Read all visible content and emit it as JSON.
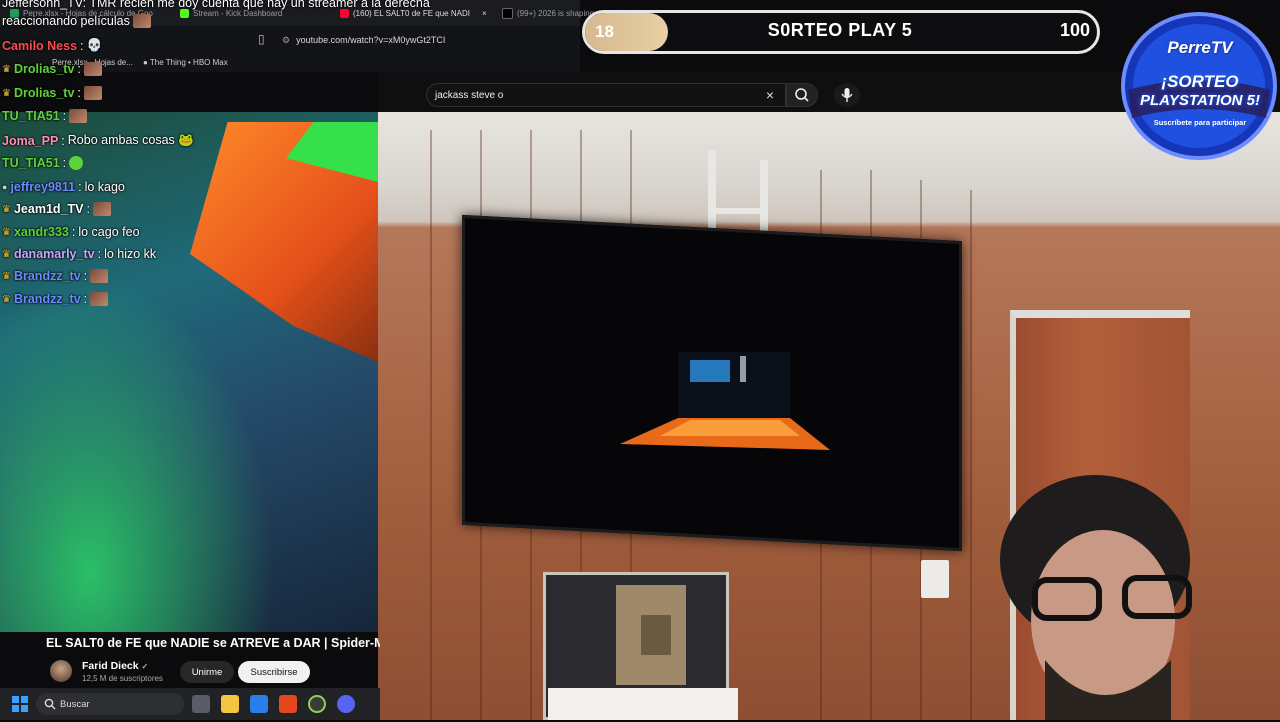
{
  "browser": {
    "tabs": [
      {
        "label": "Perre.xlsx - Hojas de cálculo de Goo",
        "color": "#1f9d55"
      },
      {
        "label": "Stream - Kick Dashboard",
        "color": "#53fc18"
      },
      {
        "label": "(160) EL SALT0 de FE que NADI",
        "color": "#ff0033"
      },
      {
        "label": "(99+) 2026 is shaping",
        "color": "#000000"
      }
    ],
    "close_tab": "×",
    "url": "youtube.com/watch?v=xM0ywGt2TCI",
    "bookmarks": [
      {
        "label": "Perre.xlsx - Hojas de..."
      },
      {
        "label": "The Thing • HBO Max"
      }
    ]
  },
  "youtube": {
    "search_query": "jackass steve o",
    "clear_label": "×",
    "video_title": "EL SALT0 de FE que NADIE se ATREVE a DAR | Spider-M",
    "channel_name": "Farid Dieck",
    "verified": "✓",
    "subscribers": "12,5 M de suscriptores",
    "join_label": "Unirme",
    "subscribe_label": "Suscribirse"
  },
  "chat": {
    "top_line1": "Jeffersonn_TV: TMR recién me doy cuenta que hay un streamer a la derecha",
    "top_line2": "reaccionando películas",
    "messages": [
      {
        "user": "Camilo Ness",
        "color": "#ff4a4a",
        "text": "💀",
        "crown": false,
        "emote": ""
      },
      {
        "user": "Drolias_tv",
        "color": "#5fd23a",
        "text": "",
        "crown": true,
        "emote": "face"
      },
      {
        "user": "Drolias_tv",
        "color": "#5fd23a",
        "text": "",
        "crown": true,
        "emote": "face"
      },
      {
        "user": "TU_TIA51",
        "color": "#5fd23a",
        "text": "",
        "crown": false,
        "emote": "face"
      },
      {
        "user": "Joma_PP",
        "color": "#ff8fb0",
        "text": "Robo ambas cosas 🐸",
        "crown": false,
        "emote": ""
      },
      {
        "user": "TU_TIA51",
        "color": "#5fd23a",
        "text": "",
        "crown": false,
        "emote": "green"
      },
      {
        "user": "jeffrey9811",
        "color": "#6b8cff",
        "text": "lo kago",
        "crown": false,
        "emote": ""
      },
      {
        "user": "Jeam1d_TV",
        "color": "#ffffff",
        "text": "",
        "crown": true,
        "emote": "face"
      },
      {
        "user": "xandr333",
        "color": "#5fd23a",
        "text": "lo cago feo",
        "crown": true,
        "emote": ""
      },
      {
        "user": "danamarly_tv",
        "color": "#c9a6ff",
        "text": "lo hizo kk",
        "crown": true,
        "emote": ""
      },
      {
        "user": "Brandzz_tv",
        "color": "#6b8cff",
        "text": "",
        "crown": true,
        "emote": "face"
      },
      {
        "user": "Brandzz_tv",
        "color": "#6b8cff",
        "text": "",
        "crown": true,
        "emote": "face"
      }
    ]
  },
  "giveaway": {
    "current": "18",
    "title": "S0RTEO PLAY 5",
    "goal": "100",
    "fill_fraction": 0.18
  },
  "badge": {
    "brand": "PerreTV",
    "line1": "¡SORTEO",
    "line2": "PLAYSTATION 5!",
    "line3": "Suscríbete para participar"
  },
  "taskbar": {
    "search_label": "Buscar",
    "icons": [
      "windows-start-icon",
      "search-icon",
      "task-view-icon",
      "file-explorer-icon",
      "edge-icon",
      "brave-icon",
      "chrome-icon",
      "discord-icon"
    ]
  }
}
